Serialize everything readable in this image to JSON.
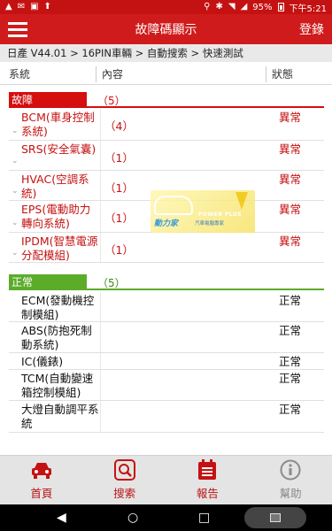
{
  "status_bar": {
    "notifications": [
      "▲",
      "✉",
      "▣",
      "⬆"
    ],
    "battery": "95%",
    "time": "下午5:21"
  },
  "app_bar": {
    "menu_icon": "hamburger-menu-icon",
    "title": "故障碼顯示",
    "login": "登錄"
  },
  "breadcrumb": "日產 V44.01 > 16PIN車輛 > 自動搜索 > 快速測試",
  "table_header": {
    "system": "系統",
    "content": "內容",
    "status": "狀態"
  },
  "fault_section": {
    "label": "故障",
    "count": "（5）",
    "color": "#d50e0e",
    "rows": [
      {
        "name": "BCM(車身控制系統)",
        "count": "（4）",
        "status": "異常"
      },
      {
        "name": "SRS(安全氣囊)",
        "count": "（1）",
        "status": "異常"
      },
      {
        "name": "HVAC(空調系統)",
        "count": "（1）",
        "status": "異常"
      },
      {
        "name": "EPS(電動助力轉向系統)",
        "count": "（1）",
        "status": "異常"
      },
      {
        "name": "IPDM(智慧電源分配模組)",
        "count": "（1）",
        "status": "異常"
      }
    ]
  },
  "normal_section": {
    "label": "正常",
    "count": "（5）",
    "color": "#5cac2a",
    "rows": [
      {
        "name": "ECM(發動機控制模組)",
        "status": "正常"
      },
      {
        "name": "ABS(防抱死制動系統)",
        "status": "正常"
      },
      {
        "name": "IC(儀錶)",
        "status": "正常"
      },
      {
        "name": "TCM(自動變速箱控制模組)",
        "status": "正常"
      },
      {
        "name": "大燈自動調平系統",
        "status": "正常"
      }
    ]
  },
  "watermark": {
    "brand": "動力家",
    "tagline": "POWER PLUS",
    "subtitle": "汽車電腦專家"
  },
  "bottom_nav": [
    {
      "label": "首頁",
      "icon": "car-home-icon"
    },
    {
      "label": "搜索",
      "icon": "search-icon"
    },
    {
      "label": "報告",
      "icon": "report-icon"
    },
    {
      "label": "幫助",
      "icon": "info-icon"
    }
  ],
  "system_nav": {
    "back": "◀",
    "home": "○",
    "recents": "□"
  }
}
